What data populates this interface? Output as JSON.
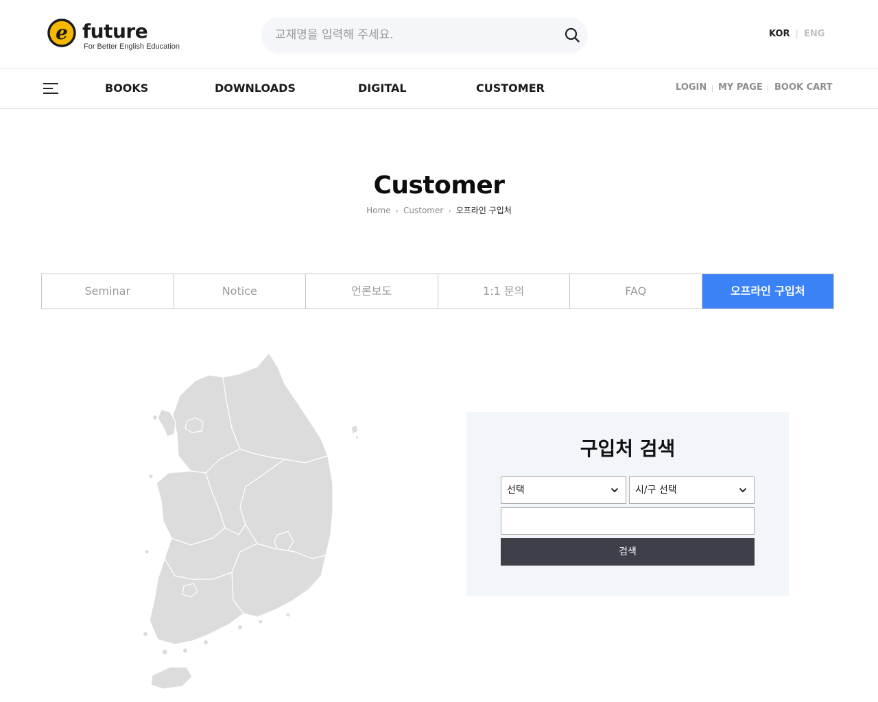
{
  "header": {
    "logo_word": "future",
    "logo_tagline": "For Better English Education",
    "search_placeholder": "교재명을 입력해 주세요.",
    "lang": {
      "kor": "KOR",
      "eng": "ENG"
    }
  },
  "nav": {
    "items": [
      "BOOKS",
      "DOWNLOADS",
      "DIGITAL",
      "CUSTOMER"
    ],
    "util": {
      "login": "LOGIN",
      "mypage": "MY PAGE",
      "cart": "BOOK CART"
    }
  },
  "page": {
    "title": "Customer",
    "breadcrumb": {
      "home": "Home",
      "section": "Customer",
      "current": "오프라인 구입처"
    }
  },
  "tabs": [
    {
      "label": "Seminar",
      "active": false
    },
    {
      "label": "Notice",
      "active": false
    },
    {
      "label": "언론보도",
      "active": false
    },
    {
      "label": "1:1 문의",
      "active": false
    },
    {
      "label": "FAQ",
      "active": false
    },
    {
      "label": "오프라인 구입처",
      "active": true
    }
  ],
  "finder": {
    "title": "구입처 검색",
    "region_select": "선택",
    "city_select": "시/구 선택",
    "keyword_value": "",
    "button": "검색"
  },
  "colors": {
    "accent": "#3b82f6",
    "logo_yellow": "#f5b800",
    "title_highlight": "#fff38a",
    "map_fill": "#dcdcdc",
    "panel_bg": "#f2f5f9",
    "button_bg": "#3e4049"
  }
}
